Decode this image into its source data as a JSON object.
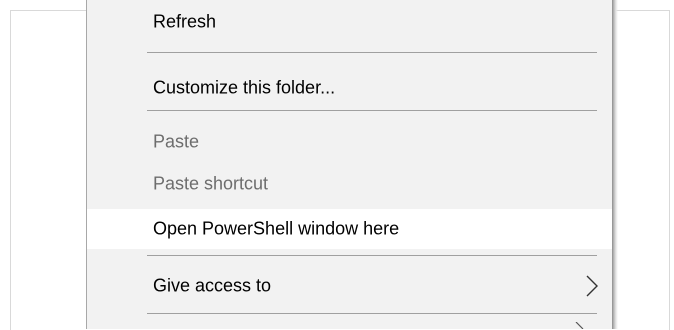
{
  "context_menu": {
    "items": [
      {
        "label": "Refresh",
        "state": "enabled"
      },
      {
        "label": "Customize this folder...",
        "state": "enabled"
      },
      {
        "label": "Paste",
        "state": "disabled"
      },
      {
        "label": "Paste shortcut",
        "state": "disabled"
      },
      {
        "label": "Open PowerShell window here",
        "state": "hovered"
      },
      {
        "label": "Give access to",
        "state": "enabled",
        "submenu_icon": "chevron-right-icon"
      }
    ]
  },
  "colors": {
    "menu_background": "#f2f2f2",
    "hover_background": "#ffffff",
    "text": "#000000",
    "disabled_text": "#6d6d6d",
    "separator": "#a0a0a0"
  }
}
